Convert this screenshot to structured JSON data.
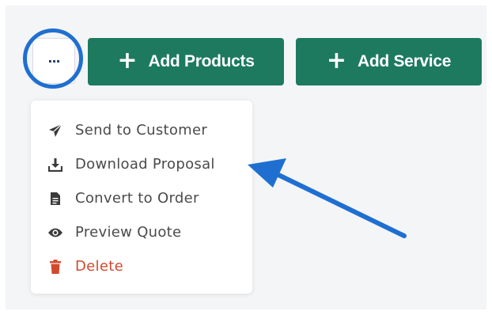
{
  "toolbar": {
    "more_label": "...",
    "add_products_label": "Add Products",
    "add_service_label": "Add Service",
    "plus_symbol": "+"
  },
  "menu": {
    "items": [
      {
        "label": "Send to Customer",
        "icon": "paper-plane-icon"
      },
      {
        "label": "Download Proposal",
        "icon": "download-icon"
      },
      {
        "label": "Convert to Order",
        "icon": "document-icon"
      },
      {
        "label": "Preview Quote",
        "icon": "eye-icon"
      },
      {
        "label": "Delete",
        "icon": "trash-icon"
      }
    ]
  },
  "colors": {
    "primary_button": "#1d7a5f",
    "highlight": "#1f6fd1",
    "delete": "#d24a2e",
    "menu_text": "#4a4a4a"
  }
}
